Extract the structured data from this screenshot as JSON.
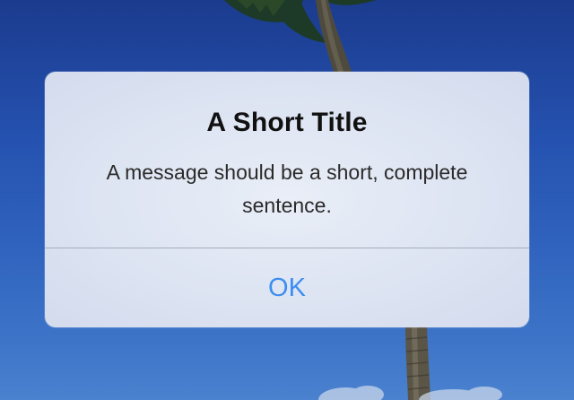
{
  "alert": {
    "title": "A Short Title",
    "message": "A message should be a short, complete sentence.",
    "button_label": "OK"
  },
  "colors": {
    "button_text": "#3c8ef0",
    "wallpaper_sky": "#2552b0"
  }
}
